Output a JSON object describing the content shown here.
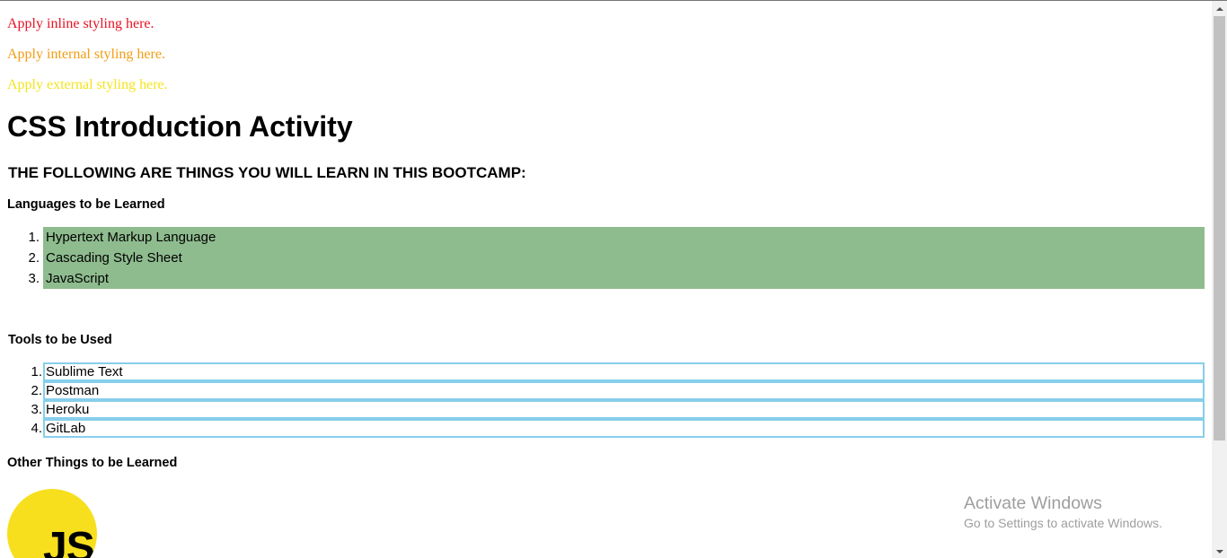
{
  "styling_lines": {
    "inline": "Apply inline styling here.",
    "internal": "Apply internal styling here.",
    "external": "Apply external styling here."
  },
  "title": "CSS Introduction Activity",
  "subtitle": "THE FOLLOWING ARE THINGS YOU WILL LEARN IN THIS BOOTCAMP:",
  "languages": {
    "heading": "Languages to be Learned",
    "items": [
      {
        "num": "1.",
        "label": "Hypertext Markup Language"
      },
      {
        "num": "2.",
        "label": "Cascading Style Sheet"
      },
      {
        "num": "3.",
        "label": "JavaScript"
      }
    ]
  },
  "tools": {
    "heading": "Tools to be Used",
    "items": [
      {
        "num": "1.",
        "label": "Sublime Text"
      },
      {
        "num": "2.",
        "label": "Postman"
      },
      {
        "num": "3.",
        "label": "Heroku"
      },
      {
        "num": "4.",
        "label": "GitLab"
      }
    ]
  },
  "other": {
    "heading": "Other Things to be Learned",
    "logo_text": "JS"
  },
  "watermark": {
    "title": "Activate Windows",
    "subtitle": "Go to Settings to activate Windows."
  },
  "colors": {
    "inline_text": "#e81123",
    "internal_text": "#f39c12",
    "external_text": "#f4e41c",
    "languages_background": "#8fbc8f",
    "tools_border": "#87ceeb",
    "js_logo": "#f7df1e"
  },
  "icons": {
    "scroll_up": "scroll-up-arrow-icon",
    "scroll_down": "scroll-down-arrow-icon",
    "logo": "javascript-logo-icon"
  }
}
